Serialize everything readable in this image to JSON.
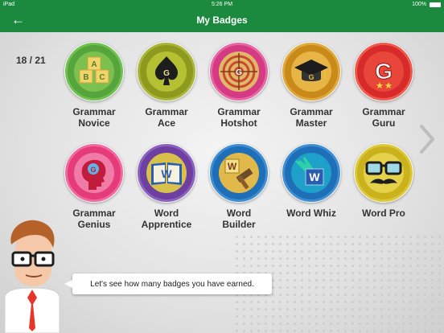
{
  "status_bar": {
    "carrier": "iPad",
    "time": "5:26 PM",
    "battery": "100%"
  },
  "header": {
    "back_icon": "←",
    "title": "My Badges"
  },
  "progress": {
    "count_label": "18 / 21"
  },
  "badges": [
    {
      "line1": "Grammar",
      "line2": "Novice",
      "ring_color": "#56a53c",
      "icon": "abc-blocks-icon"
    },
    {
      "line1": "Grammar",
      "line2": "Ace",
      "ring_color": "#8d9a1e",
      "icon": "spade-icon"
    },
    {
      "line1": "Grammar",
      "line2": "Hotshot",
      "ring_color": "#d43b84",
      "icon": "target-icon"
    },
    {
      "line1": "Grammar",
      "line2": "Master",
      "ring_color": "#c98a1a",
      "icon": "graduation-cap-icon"
    },
    {
      "line1": "Grammar",
      "line2": "Guru",
      "ring_color": "#d82a2a",
      "icon": "g-stars-icon"
    },
    {
      "line1": "Grammar",
      "line2": "Genius",
      "ring_color": "#e63b7a",
      "icon": "head-icon"
    },
    {
      "line1": "Word",
      "line2": "Apprentice",
      "ring_color": "#6c3fa0",
      "icon": "book-icon"
    },
    {
      "line1": "Word",
      "line2": "Builder",
      "ring_color": "#1e6fb8",
      "icon": "hammer-icon"
    },
    {
      "line1": "Word Whiz",
      "line2": "",
      "ring_color": "#1e6fb8",
      "icon": "w-burst-icon"
    },
    {
      "line1": "Word Pro",
      "line2": "",
      "ring_color": "#c9b21c",
      "icon": "glasses-mustache-icon"
    }
  ],
  "message": {
    "text": "Let's see how many badges you have earned."
  }
}
